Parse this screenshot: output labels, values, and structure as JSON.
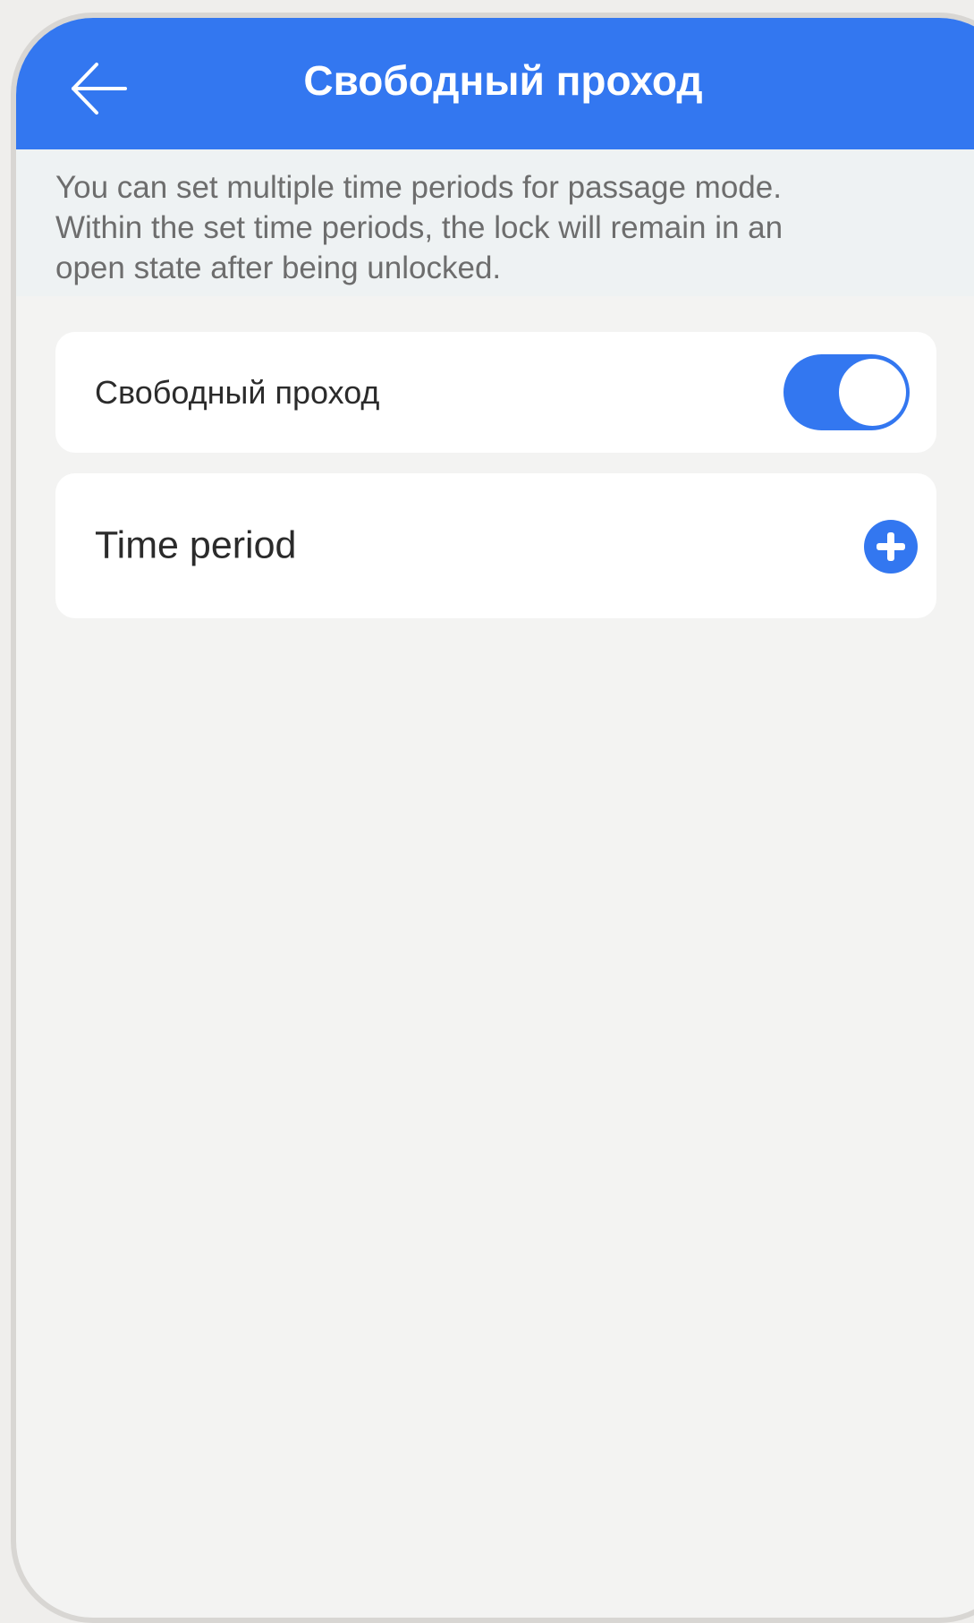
{
  "header": {
    "title": "Свободный проход",
    "back_icon": "arrow-left-icon"
  },
  "info": {
    "text": "You can set multiple time periods for passage mode. Within the set time periods, the lock will remain in an open state after being unlocked."
  },
  "passage_mode": {
    "label": "Свободный проход",
    "enabled": true
  },
  "time_period": {
    "label": "Time period",
    "add_icon": "plus-circle-icon"
  },
  "colors": {
    "accent": "#3377f0",
    "background": "#f3f3f2",
    "info_background": "#eef2f3",
    "card": "#ffffff"
  }
}
